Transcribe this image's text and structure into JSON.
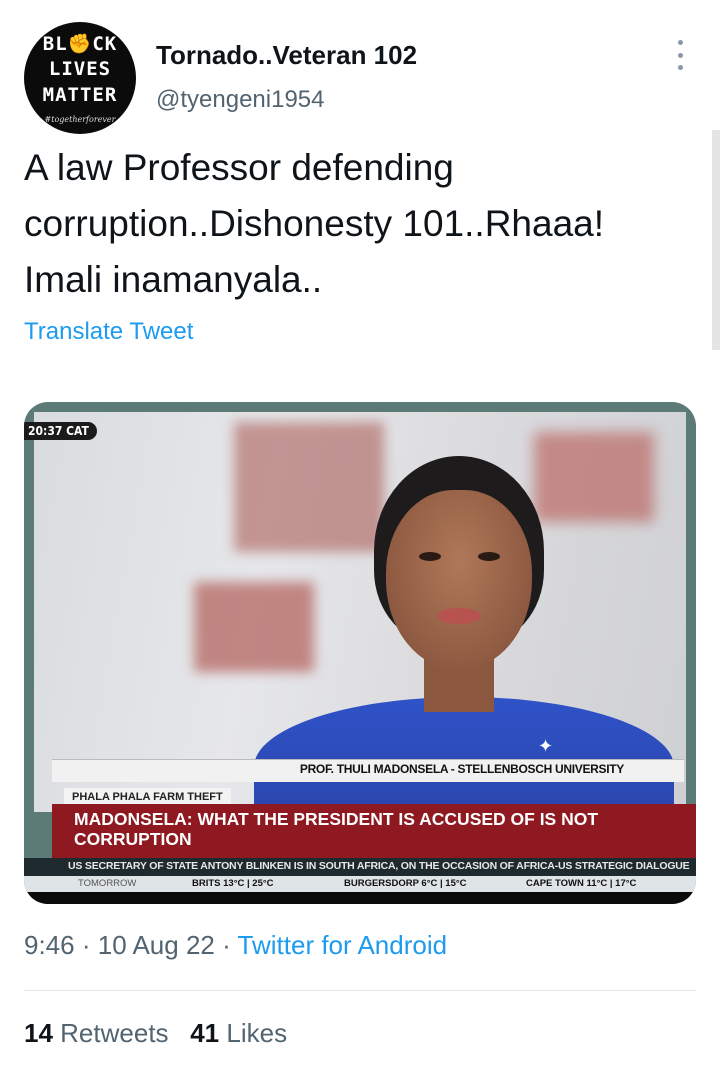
{
  "author": {
    "avatar_lines": [
      "BL✊CK",
      "LIVES",
      "MATTER"
    ],
    "avatar_tagline": "#togetherforever",
    "display_name": "Tornado..Veteran 102",
    "handle": "@tyengeni1954",
    "more_icon": "vertical-ellipsis-icon"
  },
  "tweet": {
    "text": "A law Professor defending corruption..Dishonesty 101..Rhaaa! Imali inamanyala..",
    "translate_label": "Translate Tweet"
  },
  "media": {
    "time_bug": "20:37 CAT",
    "lower_third_name": "PROF. THULI MADONSELA - STELLENBOSCH UNIVERSITY",
    "section_tag": "PHALA PHALA FARM THEFT",
    "headline": "MADONSELA: WHAT THE PRESIDENT IS ACCUSED OF IS NOT CORRUPTION",
    "ticker": "US SECRETARY OF STATE ANTONY BLINKEN IS IN SOUTH AFRICA, ON THE OCCASION OF AFRICA-US STRATEGIC DIALOGUE",
    "weather_label": "TOMORROW",
    "weather": [
      "BRITS 13°C | 25°C",
      "BURGERSDORP 6°C | 15°C",
      "CAPE TOWN 11°C | 17°C"
    ]
  },
  "meta": {
    "time": "9:46",
    "date": "10 Aug 22",
    "separator": "·",
    "source": "Twitter for Android"
  },
  "stats": {
    "retweets_count": "14",
    "retweets_label": "Retweets",
    "likes_count": "41",
    "likes_label": "Likes"
  },
  "colors": {
    "link": "#1d9bf0",
    "secondary_text": "#536471",
    "headline_bar": "#8f1920"
  }
}
